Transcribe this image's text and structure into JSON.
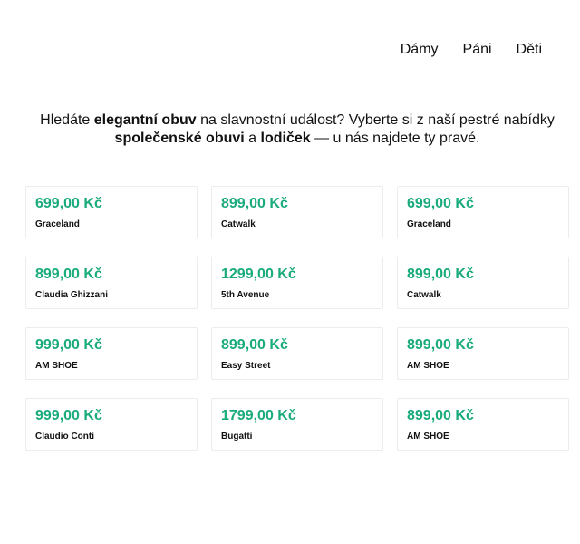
{
  "nav": {
    "items": [
      "Dámy",
      "Páni",
      "Děti"
    ]
  },
  "intro": {
    "t1": "Hledáte ",
    "b1": "elegantní obuv",
    "t2": " na slavnostní událost? Vyberte si z naší pestré nabídky ",
    "b2": "společenské obuvi",
    "t3": " a ",
    "b3": "lodiček",
    "t4": " — u nás najdete ty pravé."
  },
  "colors": {
    "price": "#1aab7d",
    "card_border": "#ececec"
  },
  "products": [
    {
      "price": "699,00 Kč",
      "brand": "Graceland"
    },
    {
      "price": "899,00 Kč",
      "brand": "Catwalk"
    },
    {
      "price": "699,00 Kč",
      "brand": "Graceland"
    },
    {
      "price": "899,00 Kč",
      "brand": "Claudia Ghizzani"
    },
    {
      "price": "1299,00 Kč",
      "brand": "5th Avenue"
    },
    {
      "price": "899,00 Kč",
      "brand": "Catwalk"
    },
    {
      "price": "999,00 Kč",
      "brand": "AM SHOE"
    },
    {
      "price": "899,00 Kč",
      "brand": "Easy Street"
    },
    {
      "price": "899,00 Kč",
      "brand": "AM SHOE"
    },
    {
      "price": "999,00 Kč",
      "brand": "Claudio Conti"
    },
    {
      "price": "1799,00 Kč",
      "brand": "Bugatti"
    },
    {
      "price": "899,00 Kč",
      "brand": "AM SHOE"
    }
  ]
}
